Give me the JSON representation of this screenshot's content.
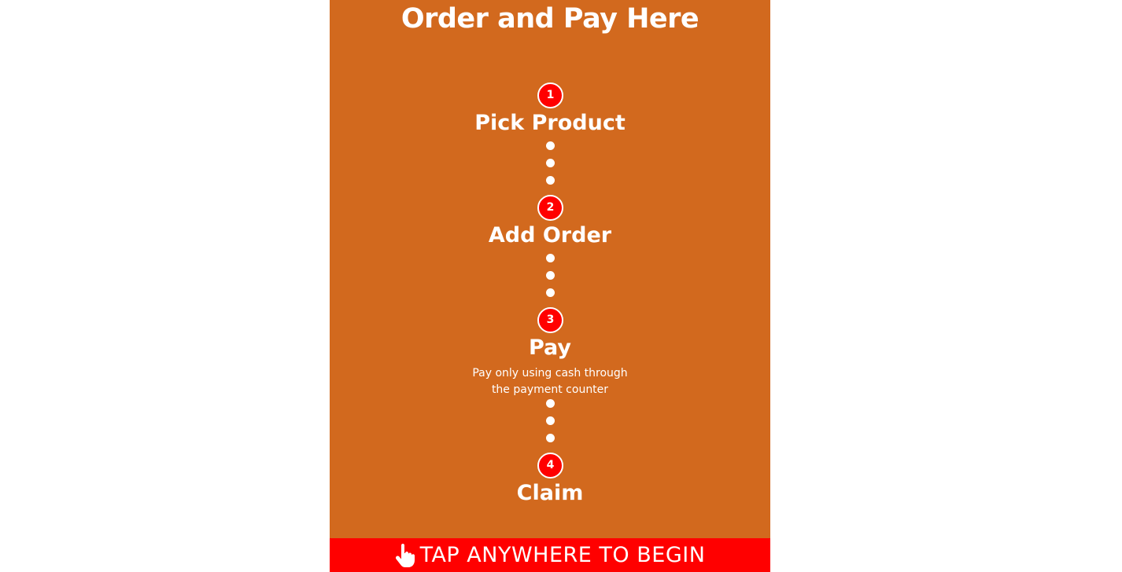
{
  "header": {
    "title": "Order and Pay Here"
  },
  "steps": [
    {
      "number": "1",
      "label": "Pick Product"
    },
    {
      "number": "2",
      "label": "Add Order"
    },
    {
      "number": "3",
      "label": "Pay",
      "description_line1": "Pay only using cash through",
      "description_line2": "the payment counter"
    },
    {
      "number": "4",
      "label": "Claim"
    }
  ],
  "cta": {
    "label": "TAP ANYWHERE TO BEGIN",
    "icon": "hand-pointer-icon"
  },
  "colors": {
    "panel_background": "#d2691e",
    "accent_red": "#ff0000",
    "text": "#ffffff"
  }
}
